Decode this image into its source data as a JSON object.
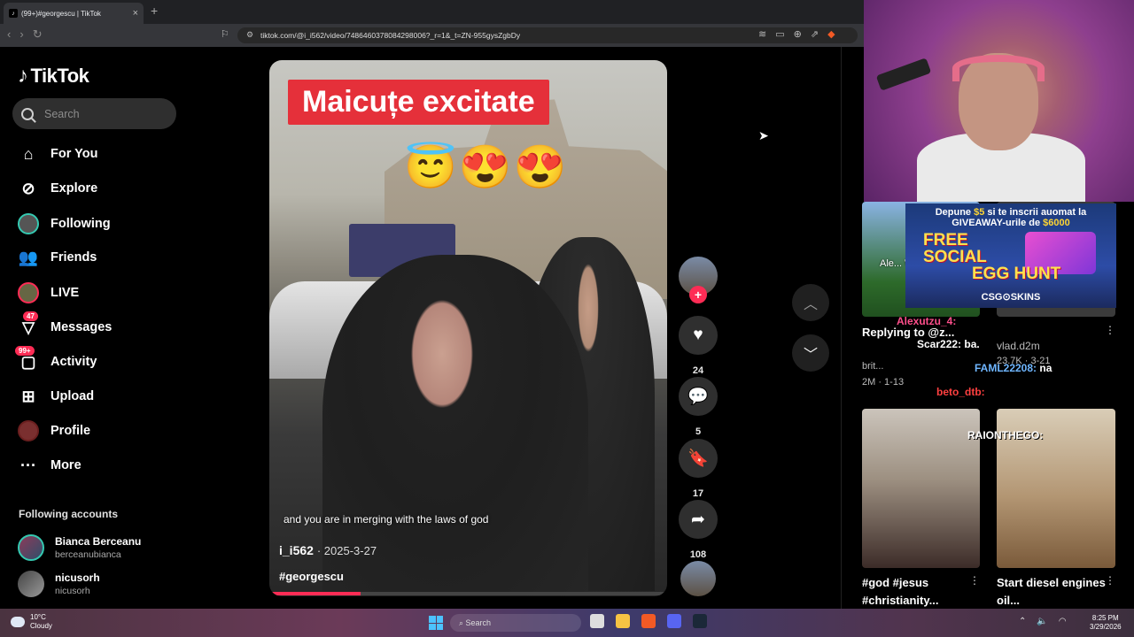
{
  "browser": {
    "tab_title": "(99+)#georgescu | TikTok",
    "url": "tiktok.com/@i_i562/video/7486460378084298006?_r=1&_t=ZN-955gysZgbDy"
  },
  "sidebar": {
    "logo": "TikTok",
    "search_placeholder": "Search",
    "items": [
      {
        "label": "For You",
        "icon": "home-icon"
      },
      {
        "label": "Explore",
        "icon": "compass-icon"
      },
      {
        "label": "Following",
        "icon": "following-avatar-icon"
      },
      {
        "label": "Friends",
        "icon": "friends-icon"
      },
      {
        "label": "LIVE",
        "icon": "live-icon"
      },
      {
        "label": "Messages",
        "icon": "messages-icon",
        "badge": "47"
      },
      {
        "label": "Activity",
        "icon": "activity-icon",
        "badge": "99+"
      },
      {
        "label": "Upload",
        "icon": "upload-icon"
      },
      {
        "label": "Profile",
        "icon": "profile-icon"
      },
      {
        "label": "More",
        "icon": "more-icon"
      }
    ],
    "following_title": "Following accounts",
    "following": [
      {
        "name": "Bianca Berceanu",
        "username": "berceanubianca"
      },
      {
        "name": "nicusorh",
        "username": "nicusorh"
      }
    ]
  },
  "video": {
    "overlay_title": "Maicuțe excitate",
    "emojis": "😇😍😍",
    "caption": "and you are in merging with the laws of god",
    "author": "i_i562",
    "date": "2025-3-27",
    "hashtag": "#georgescu",
    "progress": 0.23
  },
  "actions": {
    "likes": "24",
    "comments": "5",
    "saves": "17",
    "shares": "108"
  },
  "stream_overlay": {
    "promo_line1_a": "Depune ",
    "promo_line1_b": "$5",
    "promo_line1_c": " si te inscrii auomat la",
    "promo_line2_a": "GIVEAWAY-urile de ",
    "promo_line2_b": "$6000",
    "promo_big1": "FREE",
    "promo_big2": "SOCIAL",
    "promo_big3": "EGG HUNT",
    "promo_brand": "CSG⊙SKINS",
    "chat": [
      {
        "user": "Alexutzu_4:",
        "msg": ""
      },
      {
        "user": "Scar222:",
        "msg": "ba."
      },
      {
        "user": "FAML22208:",
        "msg": "na"
      },
      {
        "user": "beto_dtb:",
        "msg": ""
      },
      {
        "user": "RAIONTHEGO:",
        "msg": ""
      }
    ]
  },
  "recommended": [
    {
      "title": "Replying to @z...",
      "author": "brit...",
      "stats": "2M · 1-13",
      "thumb_text": "Ale... Was Fe..."
    },
    {
      "title": "",
      "author": "vlad.d2m",
      "stats": "23.7K · 3-21"
    },
    {
      "title": "#god #jesus #christianity...",
      "author": "",
      "stats": ""
    },
    {
      "title": "Start diesel engines oil...",
      "author": "",
      "stats": ""
    }
  ],
  "taskbar": {
    "weather_temp": "10°C",
    "weather_desc": "Cloudy",
    "search": "Search",
    "time": "8:25 PM",
    "date": "3/29/2026"
  },
  "colors": {
    "accent": "#fe2c55",
    "following_ring": "#35c9b1"
  }
}
